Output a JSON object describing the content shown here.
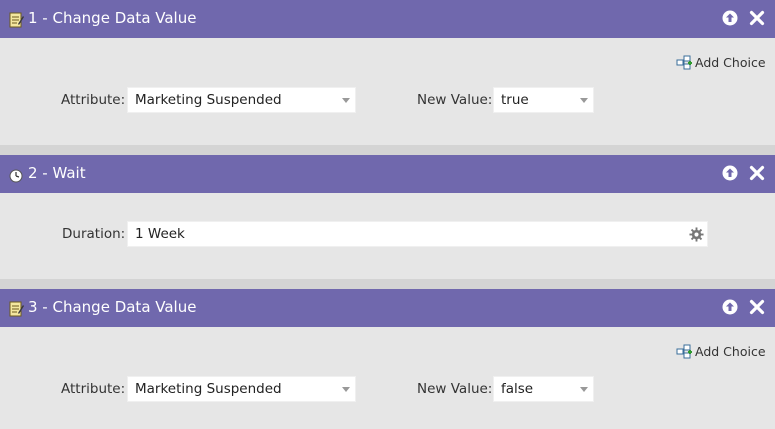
{
  "steps": [
    {
      "title": "1 - Change Data Value",
      "type_icon": "document-edit-icon",
      "add_choice_label": "Add Choice",
      "attribute_label": "Attribute:",
      "attribute_value": "Marketing Suspended",
      "new_value_label": "New Value:",
      "new_value": "true"
    },
    {
      "title": "2 - Wait",
      "type_icon": "clock-icon",
      "duration_label": "Duration:",
      "duration_value": "1 Week"
    },
    {
      "title": "3 - Change Data Value",
      "type_icon": "document-edit-icon",
      "add_choice_label": "Add Choice",
      "attribute_label": "Attribute:",
      "attribute_value": "Marketing Suspended",
      "new_value_label": "New Value:",
      "new_value": "false"
    }
  ],
  "colors": {
    "header": "#7068ad",
    "panel": "#e6e6e6",
    "separator": "#d4d4d4"
  }
}
